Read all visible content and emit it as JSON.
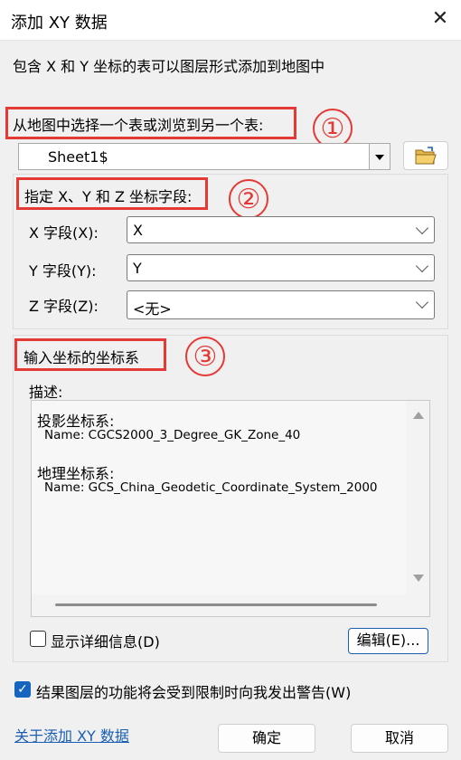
{
  "window": {
    "title": "添加 XY 数据",
    "close": "✕"
  },
  "intro": "包含 X 和 Y 坐标的表可以图层形式添加到地图中",
  "step1": {
    "label": "从地图中选择一个表或浏览到另一个表:",
    "marker": "①",
    "table_value": "Sheet1$"
  },
  "step2": {
    "label": "指定 X、Y 和 Z 坐标字段:",
    "marker": "②",
    "fields": [
      {
        "label": "X 字段(X):",
        "value": "X"
      },
      {
        "label": "Y 字段(Y):",
        "value": "Y"
      },
      {
        "label": "Z 字段(Z):",
        "value": "<无>"
      }
    ]
  },
  "step3": {
    "label": "输入坐标的坐标系",
    "marker": "③",
    "desc_label": "描述:",
    "desc_lines": [
      "投影坐标系:",
      "Name: CGCS2000_3_Degree_GK_Zone_40",
      "地理坐标系:",
      "Name: GCS_China_Geodetic_Coordinate_System_2000"
    ],
    "show_details_label": "显示详细信息(D)",
    "show_details_checked": false,
    "edit_button": "编辑(E)..."
  },
  "warning": {
    "label": "结果图层的功能将会受到限制时向我发出警告(W)",
    "checked": true
  },
  "footer": {
    "about_link": "关于添加 XY 数据",
    "ok": "确定",
    "cancel": "取消"
  },
  "colors": {
    "annotation": "#e53935",
    "link": "#1a5fb4",
    "checkbox": "#1565c0"
  }
}
